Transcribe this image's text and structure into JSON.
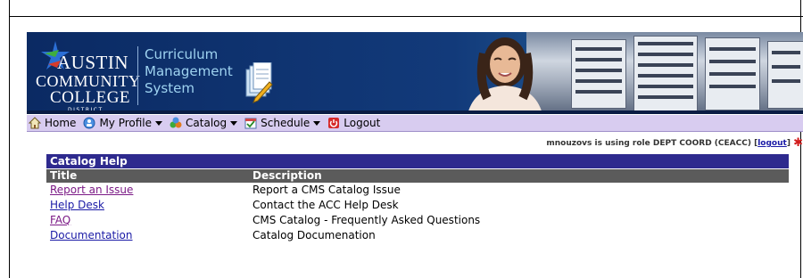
{
  "logo": {
    "line1": "AUSTIN",
    "line2": "COMMUNITY",
    "line3": "COLLEGE",
    "district": "DISTRICT"
  },
  "app_title": {
    "line1": "Curriculum",
    "line2": "Management",
    "line3": "System"
  },
  "menu": {
    "items": [
      {
        "label": "Home",
        "icon": "home-icon",
        "dropdown": false
      },
      {
        "label": "My Profile",
        "icon": "profile-icon",
        "dropdown": true
      },
      {
        "label": "Catalog",
        "icon": "catalog-icon",
        "dropdown": true
      },
      {
        "label": "Schedule",
        "icon": "schedule-icon",
        "dropdown": true
      },
      {
        "label": "Logout",
        "icon": "logout-icon",
        "dropdown": false
      }
    ]
  },
  "status": {
    "text": "mnouzovs is using role DEPT COORD (CEACC) [",
    "logout_link": "logout",
    "close": "]"
  },
  "help": {
    "title": "Catalog Help",
    "columns": [
      "Title",
      "Description"
    ],
    "rows": [
      {
        "title": "Report an Issue",
        "description": "Report a CMS Catalog Issue"
      },
      {
        "title": "Help Desk",
        "description": "Contact the ACC Help Desk"
      },
      {
        "title": "FAQ",
        "description": "CMS Catalog - Frequently Asked Questions"
      },
      {
        "title": "Documentation",
        "description": "Catalog Documenation"
      }
    ]
  },
  "colors": {
    "banner": "#0b2a63",
    "menubar": "#d8ccf0",
    "table_title": "#2e2a8e",
    "table_header": "#5b5b5b",
    "link": "#1a1aa6",
    "visited_link": "#7b1a86"
  }
}
